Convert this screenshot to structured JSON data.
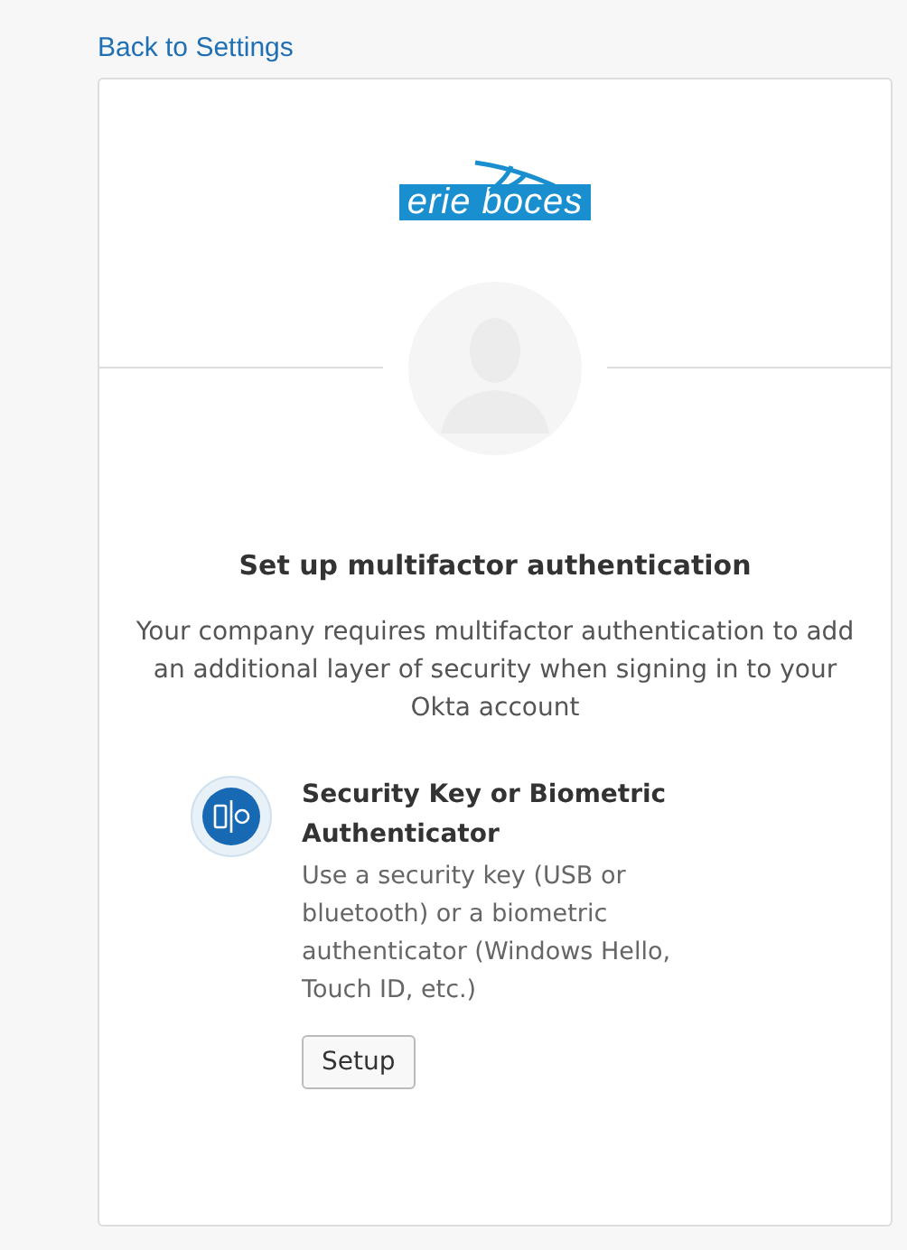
{
  "back_link": "Back to Settings",
  "logo": {
    "text": "erie boces"
  },
  "title": "Set up multifactor authentication",
  "description": "Your company requires multifactor authentication to add an additional layer of security when signing in to your Okta account",
  "factors": [
    {
      "title": "Security Key or Biometric Authenticator",
      "description": "Use a security key (USB or bluetooth) or a biometric authenticator (Windows Hello, Touch ID, etc.)",
      "button": "Setup"
    }
  ]
}
